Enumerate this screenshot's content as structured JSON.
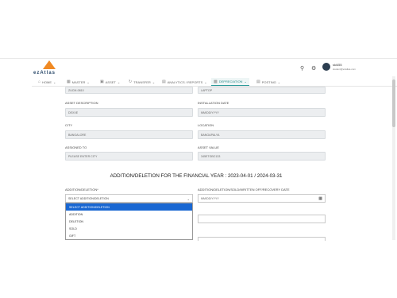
{
  "brand": {
    "logo_text": "ezAtlas"
  },
  "user": {
    "name": "skl455",
    "email": "student@ezatlas.com"
  },
  "header_icons": {
    "search": "search-icon",
    "settings": "gear-icon"
  },
  "nav": [
    {
      "label": "HOME",
      "icon": "home-icon"
    },
    {
      "label": "MASTER",
      "icon": "master-icon"
    },
    {
      "label": "ASSET",
      "icon": "asset-icon"
    },
    {
      "label": "TRANSFER",
      "icon": "transfer-icon"
    },
    {
      "label": "ANALYTICS / REPORTS",
      "icon": "analytics-icon"
    },
    {
      "label": "DEPRECIATION",
      "icon": "depreciation-icon",
      "active": true
    },
    {
      "label": "POSTING",
      "icon": "posting-icon"
    }
  ],
  "form": {
    "top_left_value": "ZUCM-0810",
    "top_right_value": "LAPTOP",
    "asset_description_label": "ASSET DESCRIPTION",
    "asset_description_value": "DEXXE",
    "installation_date_label": "INSTALLATION DATE",
    "installation_date_value": "MM/DD/YYYY",
    "city_label": "CITY",
    "city_value": "BANGALORE",
    "location_label": "LOCATION",
    "location_value": "BANGAPALYA",
    "assigned_to_label": "ASSIGNED TO",
    "assigned_to_value": "PLEASE ENTER CITY",
    "asset_value_label": "ASSET VALUE",
    "asset_value_value": "345ETGBC133"
  },
  "section_title": "ADDITION/DELETION FOR THE FINANCIAL YEAR : 2023-04-01 / 2024-03-31",
  "addition": {
    "label": "ADDITION/DELETION*",
    "selected": "SELECT ADDITION/DELETION",
    "options": [
      "SELECT ADDITION/DELETION",
      "ADDITION",
      "DELETION",
      "SOLD",
      "GIFT"
    ],
    "date_label": "ADDITION/DELETION/SOLD/WRITTEN OFF/RECOVERY DATE",
    "date_placeholder": "MM/DD/YYYY"
  }
}
